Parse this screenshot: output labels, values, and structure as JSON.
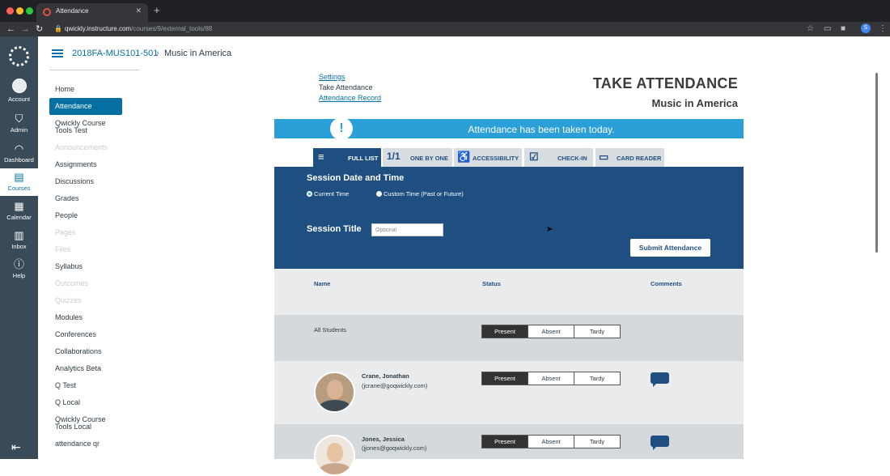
{
  "browser": {
    "tab_title": "Attendance",
    "url_host": "qwickly.instructure.com",
    "url_path": "/courses/9/external_tools/88",
    "profile_badge": "S"
  },
  "global_nav": {
    "items": [
      {
        "label": "Account",
        "icon": "account-icon"
      },
      {
        "label": "Admin",
        "icon": "admin-shield-icon"
      },
      {
        "label": "Dashboard",
        "icon": "dashboard-icon"
      },
      {
        "label": "Courses",
        "icon": "courses-book-icon"
      },
      {
        "label": "Calendar",
        "icon": "calendar-icon"
      },
      {
        "label": "Inbox",
        "icon": "inbox-icon"
      },
      {
        "label": "Help",
        "icon": "help-icon"
      }
    ]
  },
  "breadcrumb": {
    "course": "2018FA-MUS101-501",
    "separator": "›",
    "current": "Music in America"
  },
  "course_nav": {
    "items": [
      {
        "label": "Home",
        "state": "normal"
      },
      {
        "label": "Attendance",
        "state": "active"
      },
      {
        "label": "Qwickly Course Tools Test",
        "state": "normal"
      },
      {
        "label": "Announcements",
        "state": "dim"
      },
      {
        "label": "Assignments",
        "state": "normal"
      },
      {
        "label": "Discussions",
        "state": "normal"
      },
      {
        "label": "Grades",
        "state": "normal"
      },
      {
        "label": "People",
        "state": "normal"
      },
      {
        "label": "Pages",
        "state": "dim"
      },
      {
        "label": "Files",
        "state": "dim"
      },
      {
        "label": "Syllabus",
        "state": "normal"
      },
      {
        "label": "Outcomes",
        "state": "dim"
      },
      {
        "label": "Quizzes",
        "state": "dim"
      },
      {
        "label": "Modules",
        "state": "normal"
      },
      {
        "label": "Conferences",
        "state": "normal"
      },
      {
        "label": "Collaborations",
        "state": "normal"
      },
      {
        "label": "Analytics Beta",
        "state": "normal"
      },
      {
        "label": "Q Test",
        "state": "normal"
      },
      {
        "label": "Q Local",
        "state": "normal"
      },
      {
        "label": "Qwickly Course Tools Local",
        "state": "normal"
      },
      {
        "label": "attendance qr",
        "state": "normal"
      }
    ]
  },
  "tool": {
    "links": {
      "settings": "Settings",
      "take": "Take Attendance",
      "record": "Attendance Record"
    },
    "title": "TAKE ATTENDANCE",
    "subtitle": "Music in America",
    "banner": "Attendance has been taken today.",
    "banner_icon": "!",
    "tabs": [
      {
        "label": "FULL LIST",
        "icon": "≡"
      },
      {
        "label": "ONE BY ONE",
        "icon": "1/1"
      },
      {
        "label": "ACCESSIBILITY",
        "icon": "♿"
      },
      {
        "label": "CHECK-IN",
        "icon": "☑"
      },
      {
        "label": "CARD READER",
        "icon": "▭"
      }
    ],
    "session": {
      "date_heading": "Session Date and Time",
      "current_time": "Current Time",
      "custom_time": "Custom Time (Past or Future)",
      "title_label": "Session Title",
      "title_placeholder": "Optional",
      "submit": "Submit Attendance"
    },
    "table": {
      "columns": [
        "Name",
        "Status",
        "Comments"
      ],
      "all_students": "All Students",
      "status_options": [
        "Present",
        "Absent",
        "Tardy"
      ],
      "students": [
        {
          "name": "Crane, Jonathan",
          "email": "(jcrane@goqwickly.com)",
          "status": "Present"
        },
        {
          "name": "Jones, Jessica",
          "email": "(jjones@goqwickly.com)",
          "status": "Present"
        }
      ]
    }
  },
  "colors": {
    "canvas_nav": "#394b58",
    "canvas_blue": "#0770a3",
    "qwickly_navy": "#1f4f80",
    "banner": "#2a9fd8"
  }
}
